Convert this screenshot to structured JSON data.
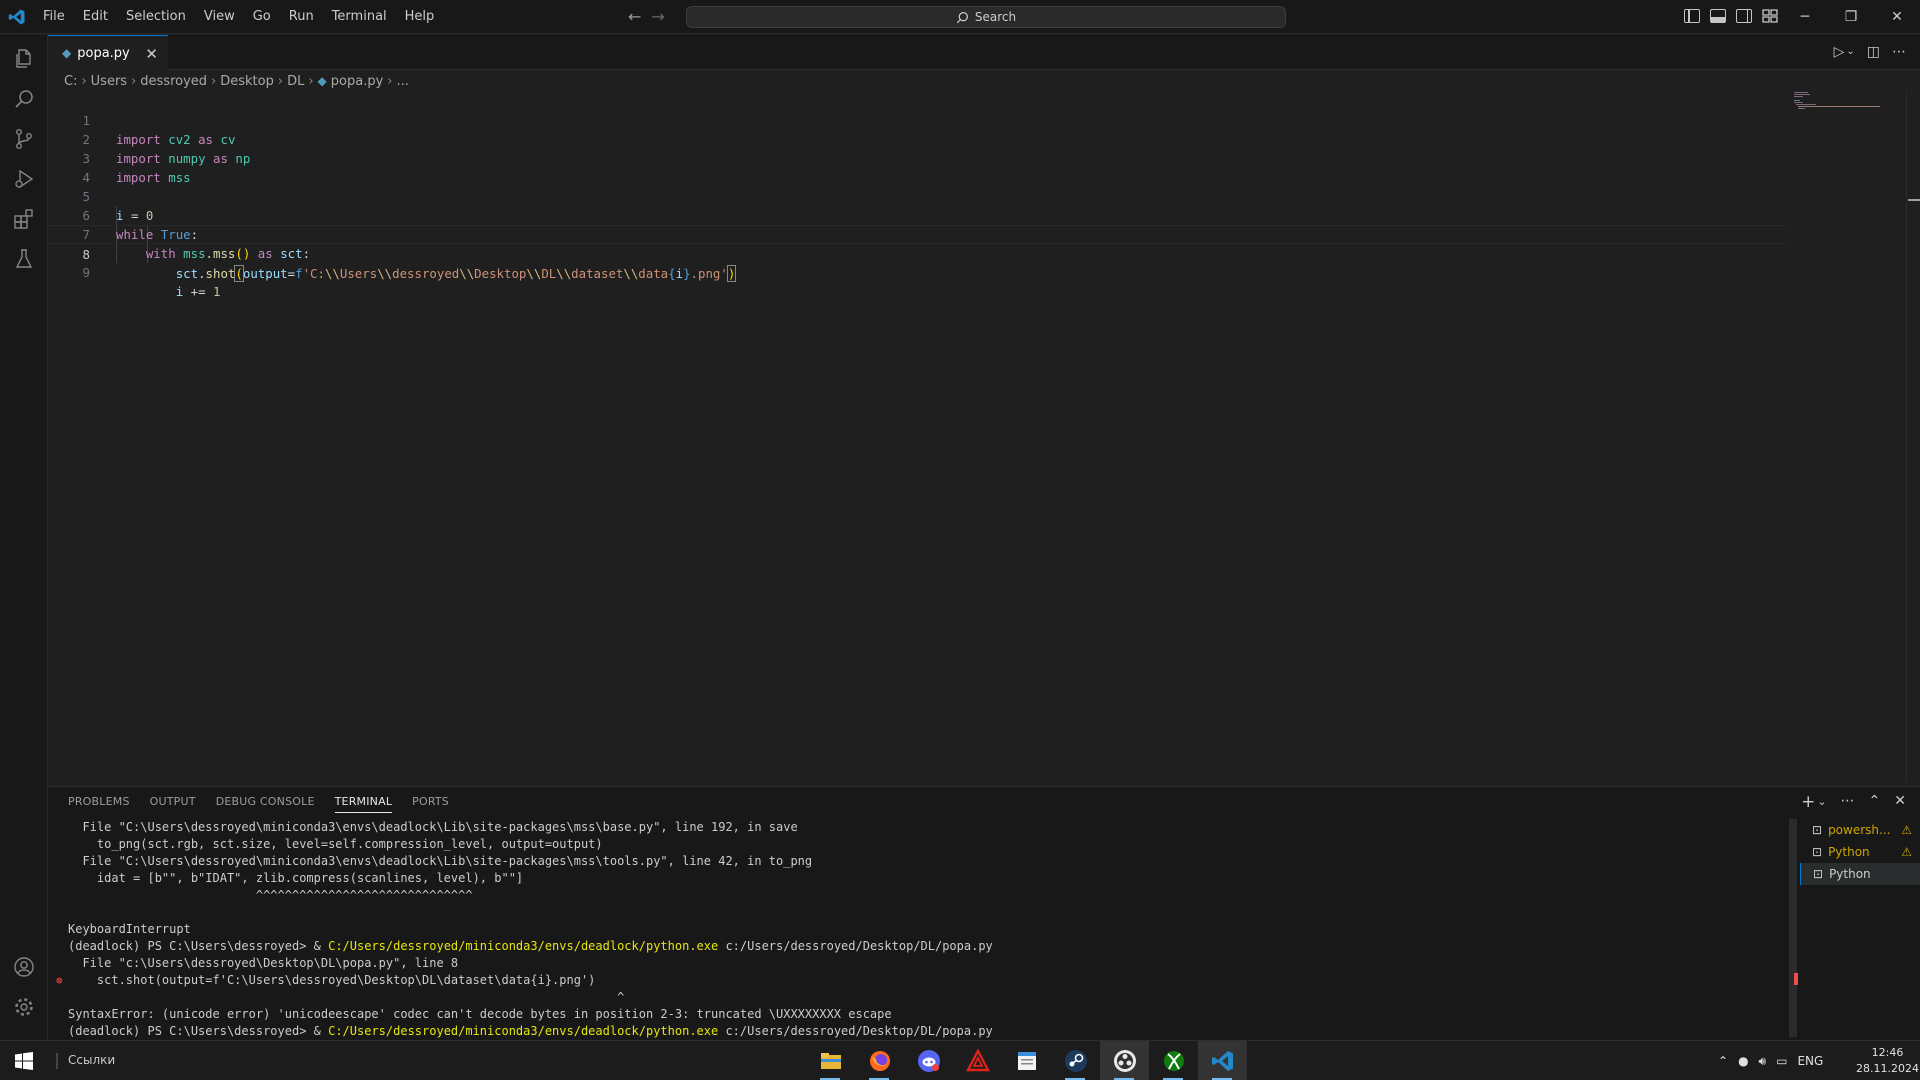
{
  "menu": [
    "File",
    "Edit",
    "Selection",
    "View",
    "Go",
    "Run",
    "Terminal",
    "Help"
  ],
  "search": {
    "label": "Search"
  },
  "tab": {
    "filename": "popa.py"
  },
  "breadcrumb": [
    "C:",
    "Users",
    "dessroyed",
    "Desktop",
    "DL",
    "popa.py",
    "..."
  ],
  "editor": {
    "active_line": 8,
    "lines": [
      "import cv2 as cv",
      "import numpy as np",
      "import mss",
      "",
      "i = 0",
      "while True:",
      "    with mss.mss() as sct:",
      "        sct.shot(output=f'C:\\\\Users\\\\dessroyed\\\\Desktop\\\\DL\\\\dataset\\\\data{i}.png')",
      "        i += 1"
    ]
  },
  "panel": {
    "tabs": [
      "PROBLEMS",
      "OUTPUT",
      "DEBUG CONSOLE",
      "TERMINAL",
      "PORTS"
    ],
    "active_tab": "TERMINAL",
    "terminal_lines": [
      "  File \"C:\\Users\\dessroyed\\miniconda3\\envs\\deadlock\\Lib\\site-packages\\mss\\base.py\", line 192, in save",
      "    to_png(sct.rgb, sct.size, level=self.compression_level, output=output)",
      "  File \"C:\\Users\\dessroyed\\miniconda3\\envs\\deadlock\\Lib\\site-packages\\mss\\tools.py\", line 42, in to_png",
      "    idat = [b\"\", b\"IDAT\", zlib.compress(scanlines, level), b\"\"]",
      "                          ^^^^^^^^^^^^^^^^^^^^^^^^^^^^^^",
      "KeyboardInterrupt",
      "(deadlock) PS C:\\Users\\dessroyed> & ",
      "  File \"c:\\Users\\dessroyed\\Desktop\\DL\\popa.py\", line 8",
      "    sct.shot(output=f'C:\\Users\\dessroyed\\Desktop\\DL\\dataset\\data{i}.png')",
      "                                                                            ^",
      "SyntaxError: (unicode error) 'unicodeescape' codec can't decode bytes in position 2-3: truncated \\UXXXXXXXX escape",
      "(deadlock) PS C:\\Users\\dessroyed> & "
    ],
    "exe_path": "C:/Users/dessroyed/miniconda3/envs/deadlock/python.exe",
    "script_arg": " c:/Users/dessroyed/Desktop/DL/popa.py",
    "terminals": [
      {
        "name": "powersh...",
        "warning": true
      },
      {
        "name": "Python",
        "warning": true
      },
      {
        "name": "Python",
        "warning": false,
        "selected": true
      }
    ]
  },
  "taskbar": {
    "links_label": "Ссылки",
    "apps": [
      "file-explorer-icon",
      "firefox-icon",
      "discord-icon",
      "adobe-acrobat-icon",
      "notepad-icon",
      "steam-icon",
      "obs-icon",
      "xbox-icon",
      "vscode-icon"
    ],
    "language": "ENG",
    "time": "12:46",
    "date": "28.11.2024"
  },
  "colors": {
    "accent": "#0078d4",
    "keyword": "#c586c0",
    "string": "#ce9178",
    "module": "#4ec9b0",
    "error": "#f14c4c"
  }
}
